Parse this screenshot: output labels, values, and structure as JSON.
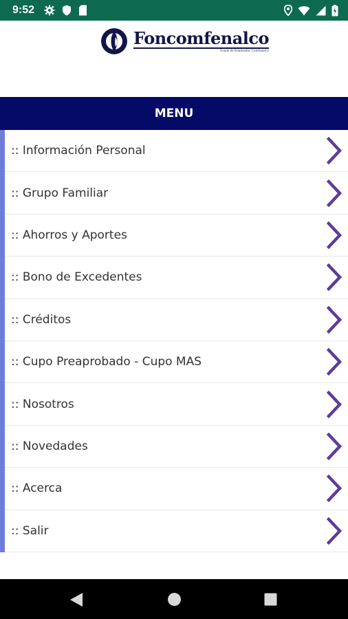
{
  "status_bar": {
    "time": "9:52",
    "left_icons": [
      "settings-icon",
      "shield-icon",
      "sim-card-icon"
    ],
    "right_icons": [
      "location-icon",
      "wifi-icon",
      "signal-icon",
      "battery-icon"
    ]
  },
  "header": {
    "logo_text": "Foncomfenalco",
    "logo_tagline": "Fondo de Empleados Comfenalco"
  },
  "menu": {
    "title": "MENU",
    "items": [
      {
        "label": ":: Información Personal"
      },
      {
        "label": ":: Grupo Familiar"
      },
      {
        "label": ":: Ahorros y Aportes"
      },
      {
        "label": ":: Bono de Excedentes"
      },
      {
        "label": ":: Créditos"
      },
      {
        "label": ":: Cupo Preaprobado - Cupo MAS"
      },
      {
        "label": ":: Nosotros"
      },
      {
        "label": ":: Novedades"
      },
      {
        "label": ":: Acerca"
      },
      {
        "label": ":: Salir"
      }
    ]
  },
  "nav_bar": {
    "buttons": [
      "back-icon",
      "home-icon",
      "recents-icon"
    ]
  },
  "colors": {
    "status_bar": "#0d6a4f",
    "menu_header": "#050a66",
    "accent_border": "#6f7cdc",
    "chevron": "#5b3c9c",
    "logo": "#121547"
  }
}
